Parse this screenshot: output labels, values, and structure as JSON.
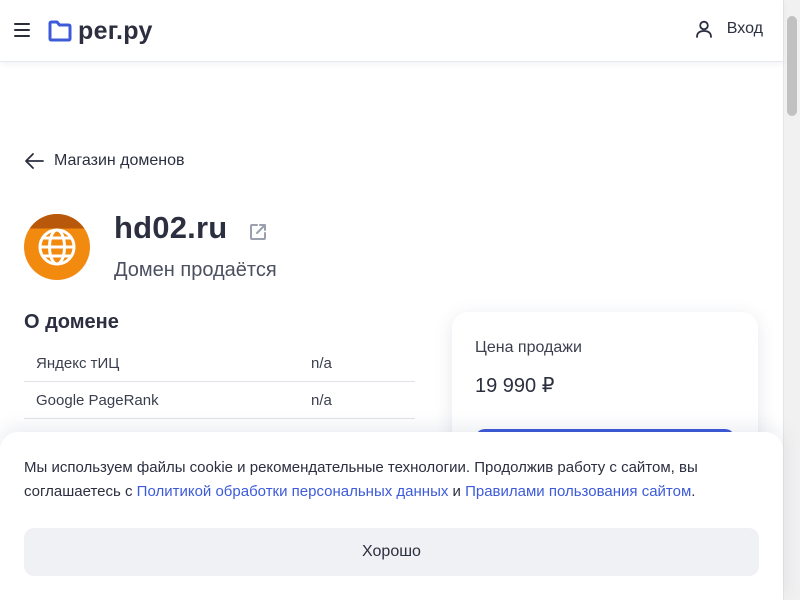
{
  "header": {
    "logo_text": "рег.ру",
    "login_label": "Вход",
    "brand_color": "#3d5bd9"
  },
  "breadcrumb": {
    "back_label": "Магазин доменов"
  },
  "domain": {
    "name": "hd02.ru",
    "status": "Домен продаётся",
    "icon": "globe-icon"
  },
  "about": {
    "title": "О домене",
    "rows": [
      {
        "key": "Яндекс тИЦ",
        "value": "n/a"
      },
      {
        "key": "Google PageRank",
        "value": "n/a"
      }
    ]
  },
  "price_card": {
    "label": "Цена продажи",
    "value": "19 990 ₽"
  },
  "cookie_banner": {
    "text_before": "Мы используем файлы cookie и рекомендательные технологии. Продолжив работу с сайтом, вы соглашаетесь с ",
    "link_privacy": "Политикой обработки персональных данных",
    "text_and": " и ",
    "link_terms": "Правилами пользования сайтом",
    "text_after": ".",
    "ok_label": "Хорошо"
  }
}
